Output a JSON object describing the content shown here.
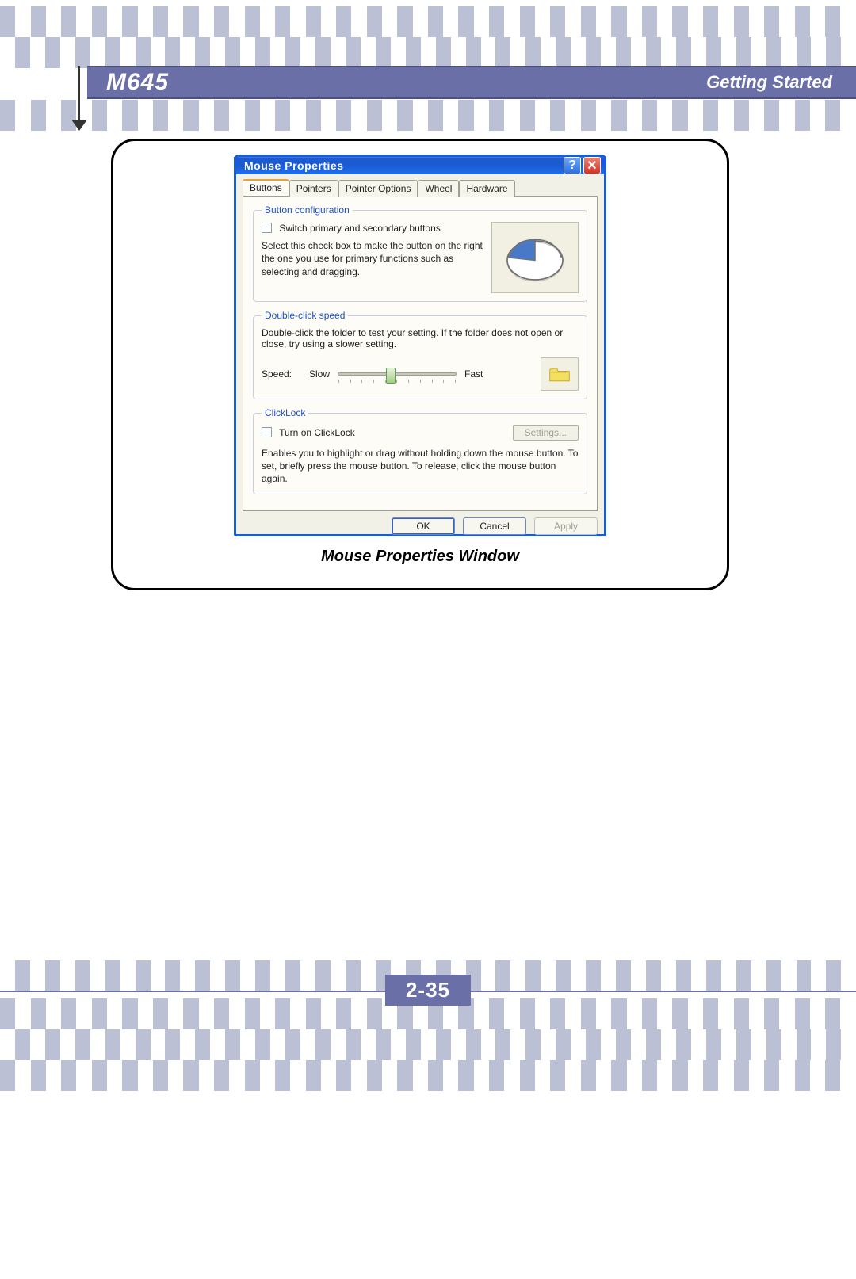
{
  "header": {
    "model": "M645",
    "section": "Getting  Started"
  },
  "figure_caption": "Mouse Properties Window",
  "page_number": "2-35",
  "window": {
    "title": "Mouse Properties",
    "tabs": [
      "Buttons",
      "Pointers",
      "Pointer Options",
      "Wheel",
      "Hardware"
    ],
    "button_config": {
      "legend": "Button configuration",
      "checkbox_label": "Switch primary and secondary buttons",
      "description": "Select this check box to make the button on the right the one you use for primary functions such as selecting and dragging."
    },
    "double_click": {
      "legend": "Double-click speed",
      "description": "Double-click the folder to test your setting. If the folder does not open or close, try using a slower setting.",
      "speed_label": "Speed:",
      "slow_label": "Slow",
      "fast_label": "Fast"
    },
    "click_lock": {
      "legend": "ClickLock",
      "checkbox_label": "Turn on ClickLock",
      "settings_button": "Settings...",
      "description": "Enables you to highlight or drag without holding down the mouse button. To set, briefly press the mouse button. To release, click the mouse button again."
    },
    "buttons": {
      "ok": "OK",
      "cancel": "Cancel",
      "apply": "Apply"
    }
  }
}
